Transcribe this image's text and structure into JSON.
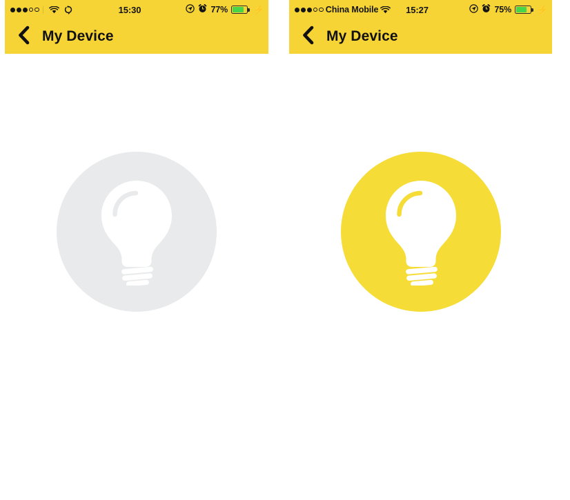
{
  "screens": [
    {
      "id": "left",
      "state_label": "off",
      "status_bar": {
        "signal_dots_filled": 3,
        "signal_dots_hollow": 2,
        "carrier": "",
        "wifi_icon": "wifi-icon",
        "sync_icon": "sync-rotate-icon",
        "time": "15:30",
        "location_icon": "location-arrow-icon",
        "alarm_icon": "alarm-clock-icon",
        "battery_percent": "77%",
        "battery_level": 77,
        "charging_icon": "lightning-bolt-icon"
      },
      "nav_bar": {
        "back_icon": "chevron-left-icon",
        "title": "My Device"
      },
      "bulb": {
        "icon": "light-bulb-icon",
        "circle_color": "#E9EAEB",
        "glyph_color": "#FFFFFF"
      }
    },
    {
      "id": "right",
      "state_label": "on",
      "status_bar": {
        "signal_dots_filled": 3,
        "signal_dots_hollow": 2,
        "carrier": "China Mobile",
        "wifi_icon": "wifi-icon",
        "sync_icon": "",
        "time": "15:27",
        "location_icon": "location-arrow-icon",
        "alarm_icon": "alarm-clock-icon",
        "battery_percent": "75%",
        "battery_level": 75,
        "charging_icon": "lightning-bolt-icon"
      },
      "nav_bar": {
        "back_icon": "chevron-left-icon",
        "title": "My Device"
      },
      "bulb": {
        "icon": "light-bulb-icon",
        "circle_color": "#F6DC36",
        "glyph_color": "#FFFFFF"
      }
    }
  ],
  "colors": {
    "header_yellow": "#F6D436",
    "bulb_on_yellow": "#F6DC36",
    "bulb_off_gray": "#E9EAEB",
    "battery_green": "#49D549",
    "page_background": "#FFFFFF"
  }
}
